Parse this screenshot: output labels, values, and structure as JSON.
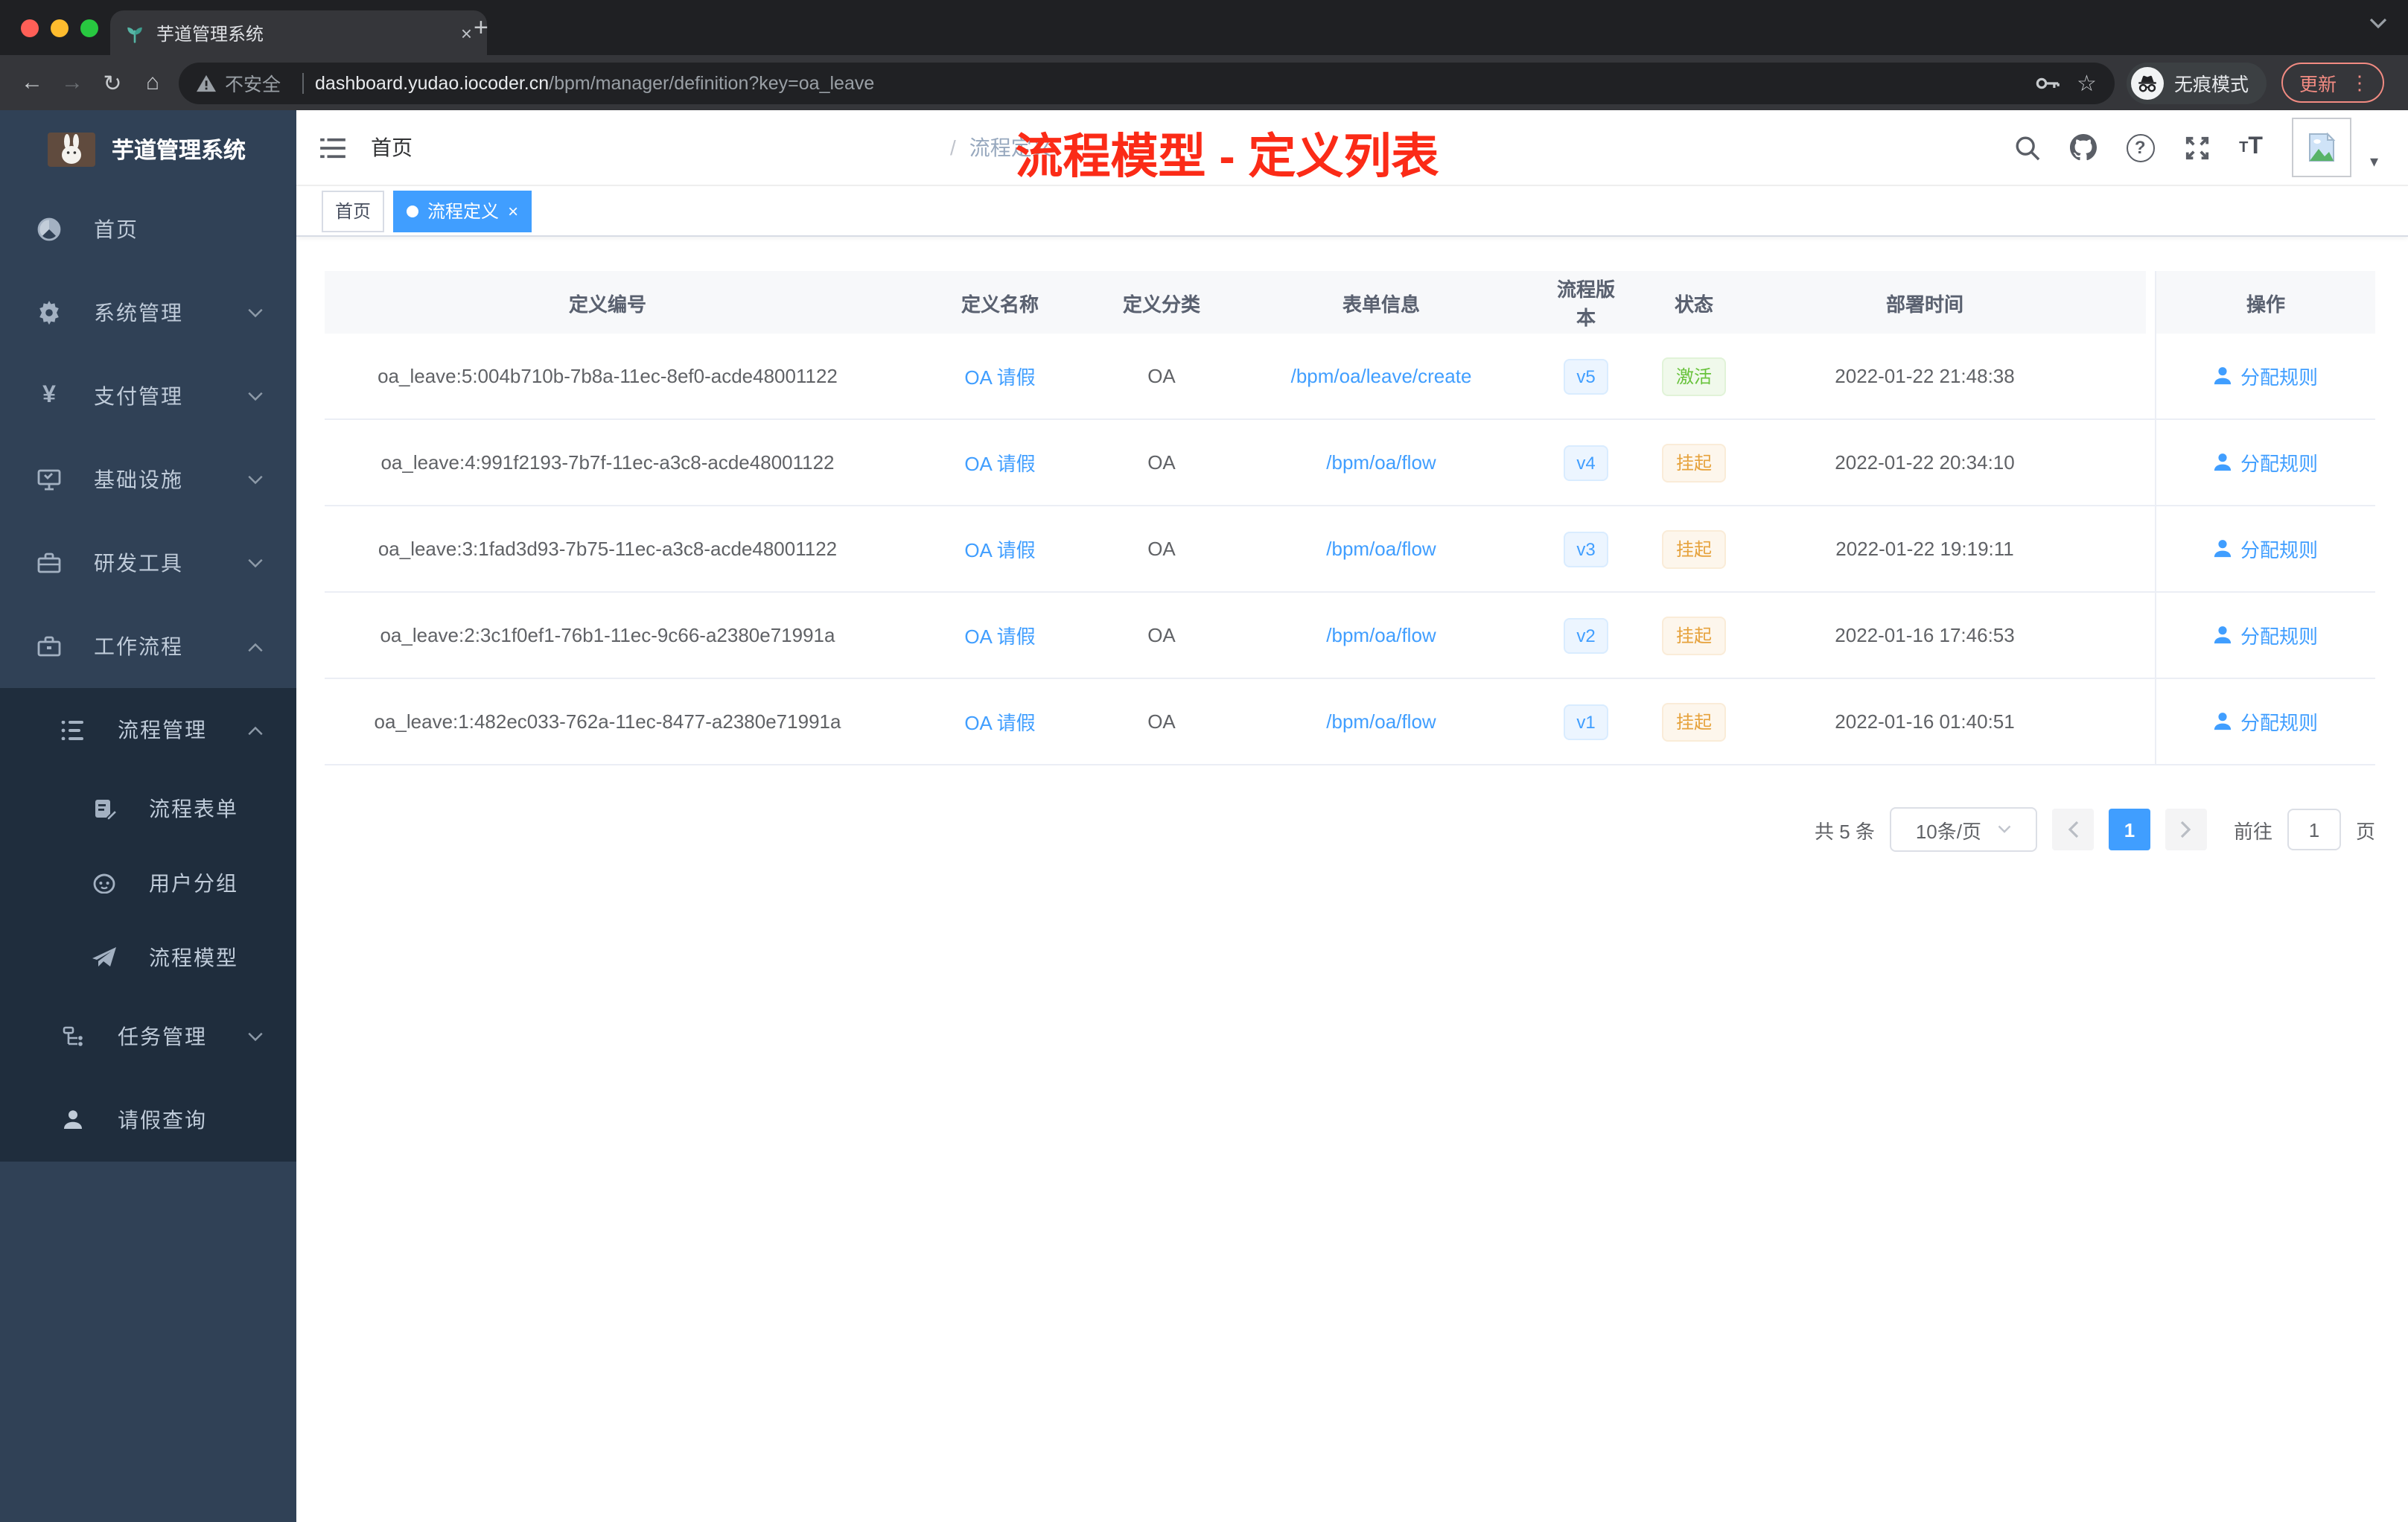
{
  "colors": {
    "accent": "#409eff",
    "success": "#67c23a",
    "warning": "#e6a23c",
    "annotation": "#fb2b17",
    "sidebar_bg": "#304156",
    "submenu_bg": "#1f2d3d"
  },
  "glyphs": {
    "close_x": "×",
    "plus": "+",
    "back": "←",
    "forward": "→",
    "reload": "↻",
    "home": "⌂",
    "star": "☆",
    "kebab": "⋮",
    "question": "?",
    "caret": "▾",
    "crumb_sep": "/",
    "size_small": "T",
    "size_big": "T"
  },
  "browser": {
    "tab_title": "芋道管理系统",
    "security_label": "不安全",
    "url_host": "dashboard.yudao.iocoder.cn",
    "url_path": "/bpm/manager/definition?key=oa_leave",
    "incognito_label": "无痕模式",
    "update_label": "更新"
  },
  "sidebar": {
    "logo_title": "芋道管理系统",
    "items": [
      {
        "label": "首页"
      },
      {
        "label": "系统管理"
      },
      {
        "label": "支付管理"
      },
      {
        "label": "基础设施"
      },
      {
        "label": "研发工具"
      },
      {
        "label": "工作流程"
      }
    ],
    "submenu": [
      {
        "label": "流程管理"
      },
      {
        "label": "流程表单"
      },
      {
        "label": "用户分组"
      },
      {
        "label": "流程模型"
      },
      {
        "label": "任务管理"
      },
      {
        "label": "请假查询"
      }
    ]
  },
  "header": {
    "breadcrumb": {
      "home": "首页",
      "current": "流程定义"
    },
    "annotation": "流程模型 - 定义列表"
  },
  "tags": {
    "items": [
      {
        "label": "首页"
      },
      {
        "label": "流程定义"
      }
    ]
  },
  "table": {
    "columns": [
      "定义编号",
      "定义名称",
      "定义分类",
      "表单信息",
      "流程版本",
      "状态",
      "部署时间",
      "操作"
    ],
    "rows": [
      {
        "id": "oa_leave:5:004b710b-7b8a-11ec-8ef0-acde48001122",
        "name": "OA 请假",
        "category": "OA",
        "form": "/bpm/oa/leave/create",
        "version": "v5",
        "status": "激活",
        "time": "2022-01-22 21:48:38",
        "action": "分配规则"
      },
      {
        "id": "oa_leave:4:991f2193-7b7f-11ec-a3c8-acde48001122",
        "name": "OA 请假",
        "category": "OA",
        "form": "/bpm/oa/flow",
        "version": "v4",
        "status": "挂起",
        "time": "2022-01-22 20:34:10",
        "action": "分配规则"
      },
      {
        "id": "oa_leave:3:1fad3d93-7b75-11ec-a3c8-acde48001122",
        "name": "OA 请假",
        "category": "OA",
        "form": "/bpm/oa/flow",
        "version": "v3",
        "status": "挂起",
        "time": "2022-01-22 19:19:11",
        "action": "分配规则"
      },
      {
        "id": "oa_leave:2:3c1f0ef1-76b1-11ec-9c66-a2380e71991a",
        "name": "OA 请假",
        "category": "OA",
        "form": "/bpm/oa/flow",
        "version": "v2",
        "status": "挂起",
        "time": "2022-01-16 17:46:53",
        "action": "分配规则"
      },
      {
        "id": "oa_leave:1:482ec033-762a-11ec-8477-a2380e71991a",
        "name": "OA 请假",
        "category": "OA",
        "form": "/bpm/oa/flow",
        "version": "v1",
        "status": "挂起",
        "time": "2022-01-16 01:40:51",
        "action": "分配规则"
      }
    ]
  },
  "pagination": {
    "total": "共 5 条",
    "page_size": "10条/页",
    "current_page": "1",
    "goto_label": "前往",
    "page_unit": "页"
  }
}
